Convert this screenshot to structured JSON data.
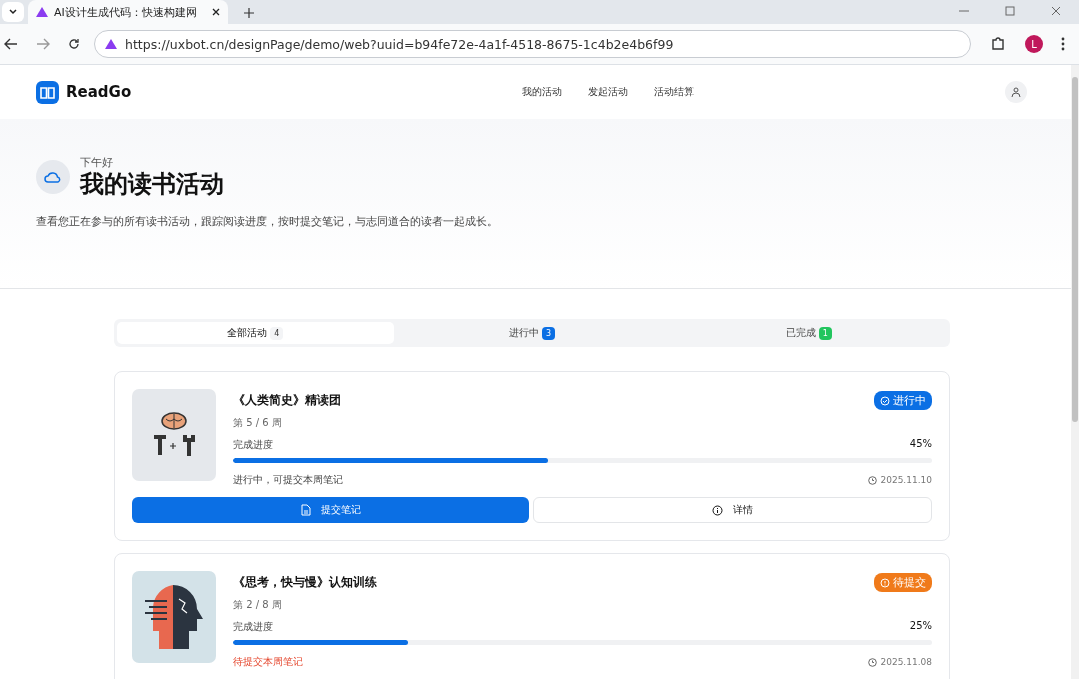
{
  "browser": {
    "tab_title": "AI设计生成代码：快速构建网",
    "url": "https://uxbot.cn/designPage/demo/web?uuid=b94fe72e-4a1f-4518-8675-1c4b2e4b6f99",
    "profile_initial": "L"
  },
  "header": {
    "logo": "ReadGo",
    "nav": [
      {
        "label": "我的活动"
      },
      {
        "label": "发起活动"
      },
      {
        "label": "活动结算"
      }
    ]
  },
  "hero": {
    "greeting": "下午好",
    "title": "我的读书活动",
    "description": "查看您正在参与的所有读书活动，跟踪阅读进度，按时提交笔记，与志同道合的读者一起成长。"
  },
  "filter_tabs": [
    {
      "label": "全部活动",
      "count": "4",
      "selected": true,
      "color": "#f3f4f6"
    },
    {
      "label": "进行中",
      "count": "3",
      "selected": false,
      "color": "#0b6fe4"
    },
    {
      "label": "已完成",
      "count": "1",
      "selected": false,
      "color": "#22c55e"
    }
  ],
  "activities": [
    {
      "title": "《人类简史》精读团",
      "week": "第 5 / 6 周",
      "progress_label": "完成进度",
      "percent": "45%",
      "level": 0.45,
      "badge": {
        "kind": "active",
        "label": "进行中"
      },
      "warning": false,
      "status_text": "进行中，可提交本周笔记",
      "date": "2025.11.10",
      "buttons": [
        {
          "kind": "primary",
          "label": "提交笔记"
        },
        {
          "kind": "secondary",
          "label": "详情"
        }
      ]
    },
    {
      "title": "《思考，快与慢》认知训练",
      "week": "第 2 / 8 周",
      "progress_label": "完成进度",
      "percent": "25%",
      "level": 0.25,
      "badge": {
        "kind": "pending",
        "label": "待提交"
      },
      "warning": true,
      "status_text": "待提交本周笔记",
      "date": "2025.11.08"
    }
  ]
}
